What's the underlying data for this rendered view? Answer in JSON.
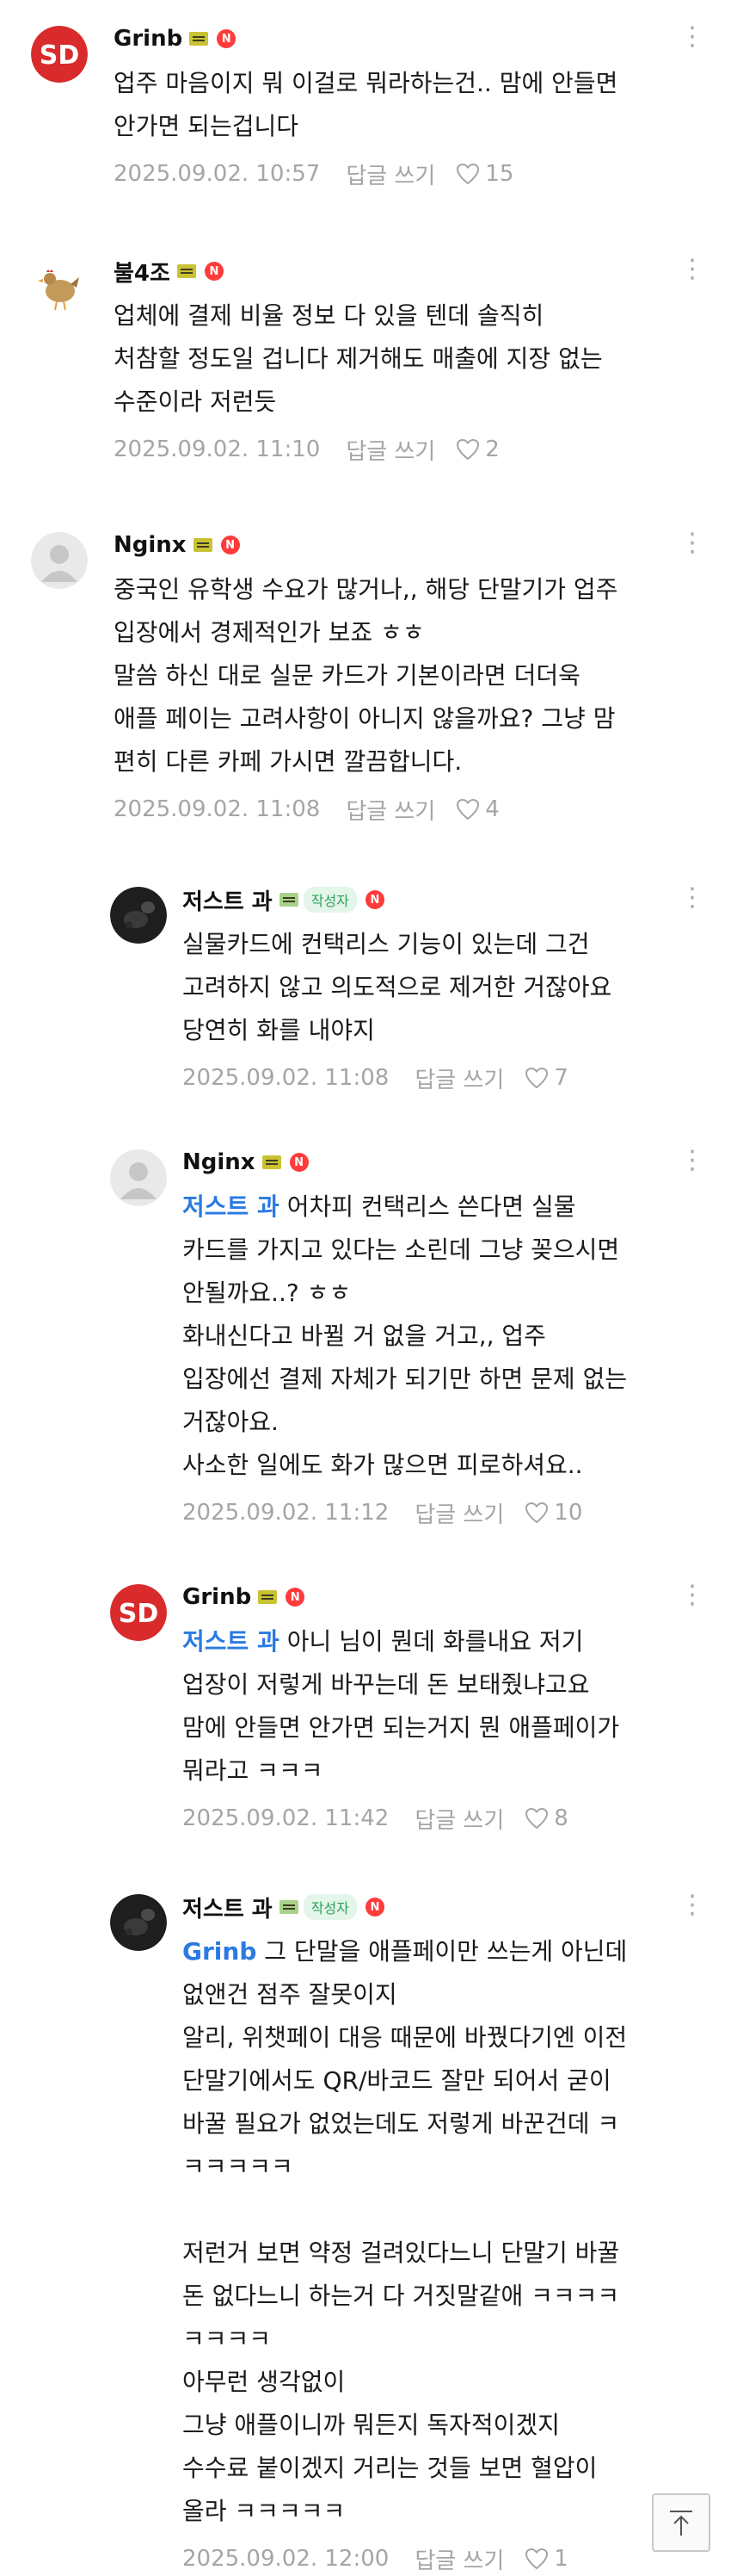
{
  "comments": [
    {
      "nickname": "Grinb",
      "avatar": "grinb-red-logo",
      "lines": [
        {
          "text": "업주 마음이지 뭐 이걸로 뭐라하는건.. 맘에 안들면"
        },
        {
          "text": "안가면 되는겁니다"
        }
      ],
      "date": "2025.09.02. 10:57",
      "reply_label": "답글 쓰기",
      "likes": "15"
    },
    {
      "nickname": "불4조",
      "avatar": "chicken",
      "lines": [
        {
          "text": "업체에 결제 비율 정보 다 있을 텐데 솔직히"
        },
        {
          "text": "처참할 정도일 겁니다 제거해도 매출에 지장 없는"
        },
        {
          "text": "수준이라 저런듯"
        }
      ],
      "date": "2025.09.02. 11:10",
      "reply_label": "답글 쓰기",
      "likes": "2"
    },
    {
      "nickname": "Nginx",
      "avatar": "default-person",
      "lines": [
        {
          "text": "중국인 유학생 수요가 많거나,, 해당 단말기가 업주"
        },
        {
          "text": "입장에서 경제적인가 보죠 ㅎㅎ"
        },
        {
          "text": "말씀 하신 대로 실문 카드가 기본이라면 더더욱"
        },
        {
          "text": "애플 페이는 고려사항이 아니지 않을까요? 그냥 맘"
        },
        {
          "text": "편히 다른 카페 가시면 깔끔합니다."
        }
      ],
      "date": "2025.09.02. 11:08",
      "reply_label": "답글 쓰기",
      "likes": "4"
    },
    {
      "nickname": "저스트 과",
      "author_badge": "작성자",
      "avatar": "dark-photo",
      "lines": [
        {
          "text": "실물카드에 컨택리스 기능이 있는데 그건"
        },
        {
          "text": "고려하지 않고 의도적으로 제거한 거잖아요"
        },
        {
          "text": "당연히 화를 내야지"
        }
      ],
      "date": "2025.09.02. 11:08",
      "reply_label": "답글 쓰기",
      "likes": "7"
    },
    {
      "nickname": "Nginx",
      "avatar": "default-person",
      "lines": [
        {
          "mention": "저스트 과",
          "text": " 어차피 컨택리스 쓴다면 실물"
        },
        {
          "text": "카드를 가지고 있다는 소린데 그냥 꽂으시면"
        },
        {
          "text": "안될까요..? ㅎㅎ"
        },
        {
          "text": "화내신다고 바뀔 거 없을 거고,, 업주"
        },
        {
          "text": "입장에선 결제 자체가 되기만 하면 문제 없는"
        },
        {
          "text": "거잖아요."
        },
        {
          "text": "사소한 일에도 화가 많으면 피로하셔요.."
        }
      ],
      "date": "2025.09.02. 11:12",
      "reply_label": "답글 쓰기",
      "likes": "10"
    },
    {
      "nickname": "Grinb",
      "avatar": "grinb-red-logo",
      "lines": [
        {
          "mention": "저스트 과",
          "text": " 아니 님이 뭔데 화를내요 저기"
        },
        {
          "text": "업장이 저렇게 바꾸는데 돈 보태줬냐고요"
        },
        {
          "text": "맘에 안들면 안가면 되는거지 뭔 애플페이가"
        },
        {
          "text": "뭐라고 ㅋㅋㅋ"
        }
      ],
      "date": "2025.09.02. 11:42",
      "reply_label": "답글 쓰기",
      "likes": "8"
    },
    {
      "nickname": "저스트 과",
      "author_badge": "작성자",
      "avatar": "dark-photo",
      "lines": [
        {
          "mention": "Grinb",
          "text": " 그 단말을 애플페이만 쓰는게 아닌데"
        },
        {
          "text": "없앤건 점주 잘못이지"
        },
        {
          "text": "알리, 위챗페이 대응 때문에 바꿨다기엔 이전"
        },
        {
          "text": "단말기에서도 QR/바코드 잘만 되어서 굳이"
        },
        {
          "text": "바꿀 필요가 없었는데도 저렇게 바꾼건데 ㅋ"
        },
        {
          "text": "ㅋㅋㅋㅋㅋ"
        },
        {
          "text": ""
        },
        {
          "text": "저런거 보면 약정 걸려있다느니 단말기 바꿀"
        },
        {
          "text": "돈 없다느니 하는거 다 거짓말같애 ㅋㅋㅋㅋ"
        },
        {
          "text": "ㅋㅋㅋㅋ"
        },
        {
          "text": "아무런 생각없이"
        },
        {
          "text": "그냥 애플이니까 뭐든지 독자적이겠지"
        },
        {
          "text": "수수료 붙이겠지 거리는 것들 보면 혈압이"
        },
        {
          "text": "올라 ㅋㅋㅋㅋㅋ"
        }
      ],
      "date": "2025.09.02. 12:00",
      "reply_label": "답글 쓰기",
      "likes": "1"
    }
  ],
  "icons": {
    "new": "N",
    "more": "⋮",
    "heart": "heart-icon",
    "scroll_top": "arrow-up-icon"
  },
  "colors": {
    "mention": "#2a7ae2",
    "new_badge": "#ff3b3b",
    "meta_text": "#a5a5a5",
    "author_badge": "#2aa25a"
  }
}
